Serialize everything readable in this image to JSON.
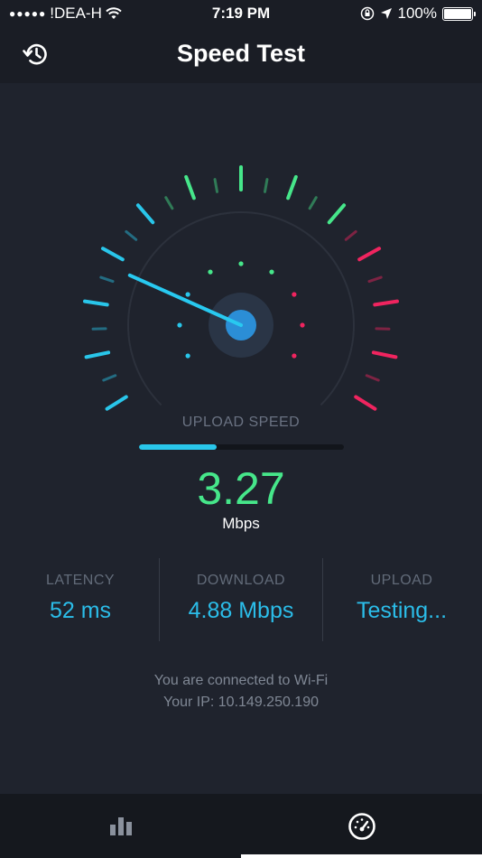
{
  "status_bar": {
    "carrier": "!DEA-H",
    "time": "7:19 PM",
    "battery": "100%"
  },
  "header": {
    "title": "Speed Test"
  },
  "gauge": {
    "needle_position": 0.23
  },
  "test": {
    "phase_label": "UPLOAD SPEED",
    "progress": 0.38,
    "speed_value": "3.27",
    "speed_unit": "Mbps"
  },
  "stats": [
    {
      "label": "LATENCY",
      "value": "52 ms"
    },
    {
      "label": "DOWNLOAD",
      "value": "4.88 Mbps"
    },
    {
      "label": "UPLOAD",
      "value": "Testing..."
    }
  ],
  "connection": {
    "line1": "You are connected to Wi-Fi",
    "line2": "Your IP: 10.149.250.190"
  },
  "tabs": [
    {
      "name": "results",
      "icon": "bar-chart-icon"
    },
    {
      "name": "speedometer",
      "icon": "speedometer-icon",
      "active": true
    }
  ],
  "colors": {
    "accent_blue": "#29c6ea",
    "accent_green": "#46e68a",
    "accent_red": "#f0245f",
    "background": "#1f232d"
  }
}
